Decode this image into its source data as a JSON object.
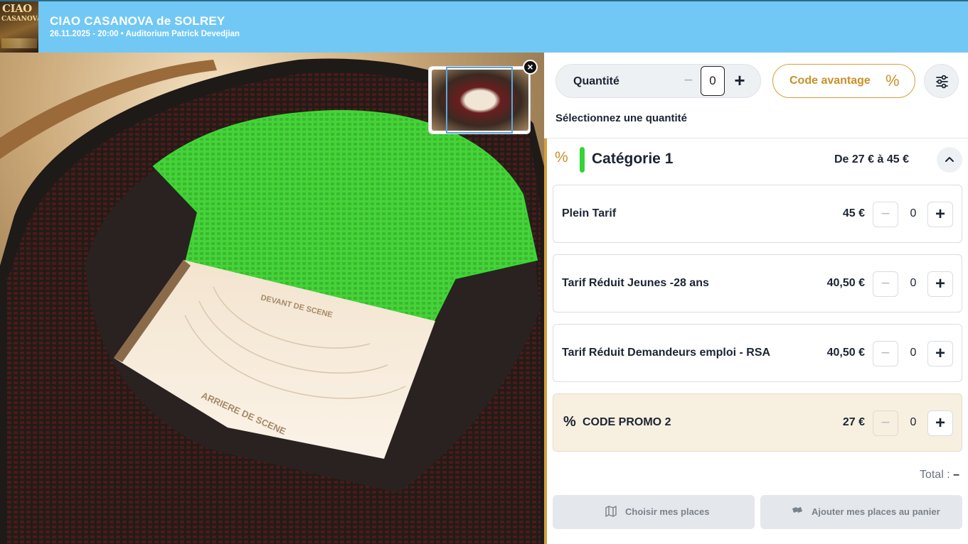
{
  "event": {
    "title": "CIAO CASANOVA de SOLREY",
    "subtitle": "26.11.2025 - 20:00 • Auditorium Patrick Devedjian",
    "poster_title": "CIAO",
    "poster_title2": "CASANOVA"
  },
  "map": {
    "stage_front_label": "DEVANT DE SCENE",
    "stage_back_label": "ARRIERE DE SCENE",
    "close_label": "×",
    "highlight_color": "#35d335"
  },
  "quantity": {
    "label": "Quantité",
    "minus": "−",
    "value": "0",
    "plus": "+",
    "hint": "Sélectionnez une quantité"
  },
  "promo_button": {
    "label": "Code avantage",
    "icon": "%"
  },
  "category": {
    "icon": "%",
    "name": "Catégorie 1",
    "range": "De 27 € à 45 €",
    "color": "#35d335",
    "toggle": "^"
  },
  "tarifs": [
    {
      "name": "Plein Tarif",
      "price": "45 €",
      "qty": "0",
      "minus": "−",
      "plus": "+"
    },
    {
      "name": "Tarif Réduit Jeunes -28 ans",
      "price": "40,50 €",
      "qty": "0",
      "minus": "−",
      "plus": "+"
    },
    {
      "name": "Tarif Réduit Demandeurs emploi - RSA",
      "price": "40,50 €",
      "qty": "0",
      "minus": "−",
      "plus": "+"
    },
    {
      "name": "CODE PROMO 2",
      "price": "27 €",
      "qty": "0",
      "minus": "−",
      "plus": "+",
      "icon": "%"
    }
  ],
  "total": {
    "label": "Total :",
    "value": "–"
  },
  "actions": {
    "choose_seats": "Choisir mes places",
    "add_to_cart": "Ajouter mes places au panier"
  },
  "colors": {
    "header": "#72c8f4",
    "accent": "#d4a03c"
  }
}
